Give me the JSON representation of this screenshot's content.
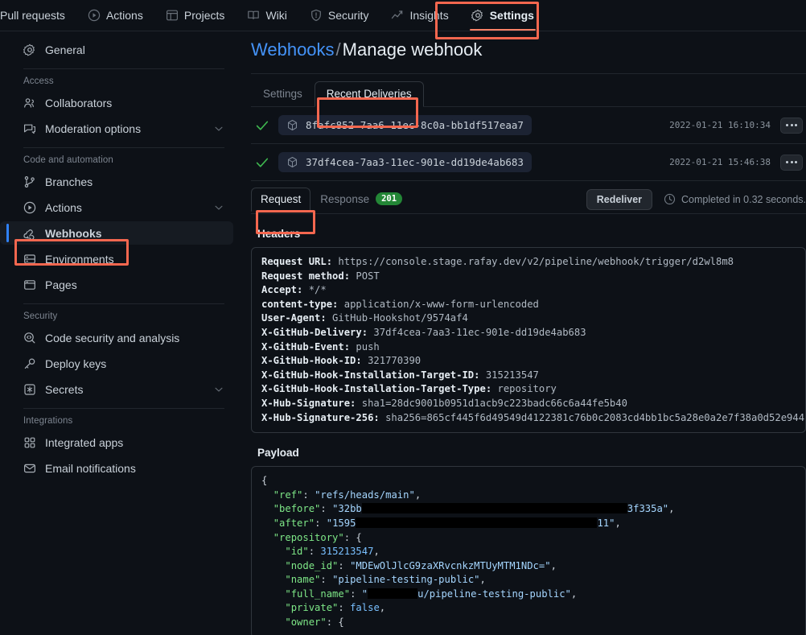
{
  "topnav": {
    "items": [
      {
        "label": "Pull requests",
        "icon": "none",
        "active": false
      },
      {
        "label": "Actions",
        "icon": "play-icon",
        "active": false
      },
      {
        "label": "Projects",
        "icon": "table-icon",
        "active": false
      },
      {
        "label": "Wiki",
        "icon": "book-icon",
        "active": false
      },
      {
        "label": "Security",
        "icon": "shield-icon",
        "active": false
      },
      {
        "label": "Insights",
        "icon": "graph-icon",
        "active": false
      },
      {
        "label": "Settings",
        "icon": "gear-icon",
        "active": true
      }
    ]
  },
  "sidebar": {
    "general": {
      "label": "General",
      "icon": "gear-icon"
    },
    "groups": [
      {
        "heading": "Access",
        "items": [
          {
            "label": "Collaborators",
            "icon": "people-icon",
            "chevron": false
          },
          {
            "label": "Moderation options",
            "icon": "comment-icon",
            "chevron": true
          }
        ]
      },
      {
        "heading": "Code and automation",
        "items": [
          {
            "label": "Branches",
            "icon": "branch-icon",
            "chevron": false
          },
          {
            "label": "Actions",
            "icon": "play-icon",
            "chevron": true
          },
          {
            "label": "Webhooks",
            "icon": "webhook-icon",
            "chevron": false,
            "selected": true
          },
          {
            "label": "Environments",
            "icon": "server-icon",
            "chevron": false
          },
          {
            "label": "Pages",
            "icon": "browser-icon",
            "chevron": false
          }
        ]
      },
      {
        "heading": "Security",
        "items": [
          {
            "label": "Code security and analysis",
            "icon": "code-scan-icon",
            "chevron": false
          },
          {
            "label": "Deploy keys",
            "icon": "key-icon",
            "chevron": false
          },
          {
            "label": "Secrets",
            "icon": "asterisk-icon",
            "chevron": true
          }
        ]
      },
      {
        "heading": "Integrations",
        "items": [
          {
            "label": "Integrated apps",
            "icon": "apps-icon",
            "chevron": false
          },
          {
            "label": "Email notifications",
            "icon": "mail-icon",
            "chevron": false
          }
        ]
      }
    ]
  },
  "breadcrumb": {
    "link": "Webhooks",
    "separator": "/",
    "current": "Manage webhook"
  },
  "tabs": [
    {
      "label": "Settings",
      "active": false
    },
    {
      "label": "Recent Deliveries",
      "active": true
    }
  ],
  "deliveries": [
    {
      "status": "success",
      "guid": "8fafc852-7aa6-11ec-8c0a-bb1df517eaa7",
      "timestamp": "2022-01-21 16:10:34"
    },
    {
      "status": "success",
      "guid": "37df4cea-7aa3-11ec-901e-dd19de4ab683",
      "timestamp": "2022-01-21 15:46:38"
    }
  ],
  "detail": {
    "request_tab": "Request",
    "response_tab": "Response",
    "response_code": "201",
    "redeliver_label": "Redeliver",
    "completed_text": "Completed in 0.32 seconds.",
    "headers_title": "Headers",
    "payload_title": "Payload",
    "headers": [
      {
        "name": "Request URL:",
        "value": "https://console.stage.rafay.dev/v2/pipeline/webhook/trigger/d2wl8m8"
      },
      {
        "name": "Request method:",
        "value": "POST"
      },
      {
        "name": "Accept:",
        "value": "*/*"
      },
      {
        "name": "content-type:",
        "value": "application/x-www-form-urlencoded"
      },
      {
        "name": "User-Agent:",
        "value": "GitHub-Hookshot/9574af4"
      },
      {
        "name": "X-GitHub-Delivery:",
        "value": "37df4cea-7aa3-11ec-901e-dd19de4ab683"
      },
      {
        "name": "X-GitHub-Event:",
        "value": "push"
      },
      {
        "name": "X-GitHub-Hook-ID:",
        "value": "321770390"
      },
      {
        "name": "X-GitHub-Hook-Installation-Target-ID:",
        "value": "315213547"
      },
      {
        "name": "X-GitHub-Hook-Installation-Target-Type:",
        "value": "repository"
      },
      {
        "name": "X-Hub-Signature:",
        "value": "sha1=28dc9001b0951d1acb9c223badc66c6a44fe5b40"
      },
      {
        "name": "X-Hub-Signature-256:",
        "value": "sha256=865cf445f6d49549d4122381c76b0c2083cd4bb1bc5a28e0a2e7f38a0d52e944"
      }
    ],
    "payload_lines": [
      {
        "indent": 0,
        "parts": [
          {
            "t": "p",
            "v": "{"
          }
        ]
      },
      {
        "indent": 1,
        "parts": [
          {
            "t": "k",
            "v": "\"ref\""
          },
          {
            "t": "p",
            "v": ": "
          },
          {
            "t": "s",
            "v": "\"refs/heads/main\""
          },
          {
            "t": "p",
            "v": ","
          }
        ]
      },
      {
        "indent": 1,
        "parts": [
          {
            "t": "k",
            "v": "\"before\""
          },
          {
            "t": "p",
            "v": ": "
          },
          {
            "t": "s",
            "v": "\"32bb"
          },
          {
            "t": "redact",
            "v": "330"
          },
          {
            "t": "s",
            "v": "3f335a\""
          },
          {
            "t": "p",
            "v": ","
          }
        ]
      },
      {
        "indent": 1,
        "parts": [
          {
            "t": "k",
            "v": "\"after\""
          },
          {
            "t": "p",
            "v": ": "
          },
          {
            "t": "s",
            "v": "\"1595"
          },
          {
            "t": "redact",
            "v": "300"
          },
          {
            "t": "s",
            "v": "11\""
          },
          {
            "t": "p",
            "v": ","
          }
        ]
      },
      {
        "indent": 1,
        "parts": [
          {
            "t": "k",
            "v": "\"repository\""
          },
          {
            "t": "p",
            "v": ": {"
          }
        ]
      },
      {
        "indent": 2,
        "parts": [
          {
            "t": "k",
            "v": "\"id\""
          },
          {
            "t": "p",
            "v": ": "
          },
          {
            "t": "n",
            "v": "315213547"
          },
          {
            "t": "p",
            "v": ","
          }
        ]
      },
      {
        "indent": 2,
        "parts": [
          {
            "t": "k",
            "v": "\"node_id\""
          },
          {
            "t": "p",
            "v": ": "
          },
          {
            "t": "s",
            "v": "\"MDEwOlJlcG9zaXRvcnkzMTUyMTM1NDc=\""
          },
          {
            "t": "p",
            "v": ","
          }
        ]
      },
      {
        "indent": 2,
        "parts": [
          {
            "t": "k",
            "v": "\"name\""
          },
          {
            "t": "p",
            "v": ": "
          },
          {
            "t": "s",
            "v": "\"pipeline-testing-public\""
          },
          {
            "t": "p",
            "v": ","
          }
        ]
      },
      {
        "indent": 2,
        "parts": [
          {
            "t": "k",
            "v": "\"full_name\""
          },
          {
            "t": "p",
            "v": ": "
          },
          {
            "t": "s",
            "v": "\""
          },
          {
            "t": "redact",
            "v": "62"
          },
          {
            "t": "s",
            "v": "u/pipeline-testing-public\""
          },
          {
            "t": "p",
            "v": ","
          }
        ]
      },
      {
        "indent": 2,
        "parts": [
          {
            "t": "k",
            "v": "\"private\""
          },
          {
            "t": "p",
            "v": ": "
          },
          {
            "t": "n",
            "v": "false"
          },
          {
            "t": "p",
            "v": ","
          }
        ]
      },
      {
        "indent": 2,
        "parts": [
          {
            "t": "k",
            "v": "\"owner\""
          },
          {
            "t": "p",
            "v": ": {"
          }
        ]
      }
    ]
  },
  "colors": {
    "background": "#0d1117",
    "accent_link": "#4493f8",
    "annotation": "#f4674f",
    "active_underline": "#f78166",
    "selected_bar": "#2f81f7",
    "success_green": "#238636",
    "check_green": "#3fb950"
  }
}
